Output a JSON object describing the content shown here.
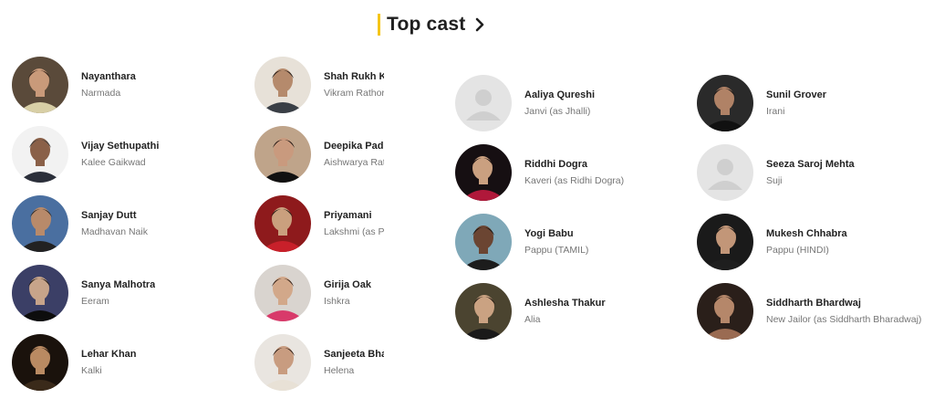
{
  "section": {
    "title": "Top cast",
    "accent": "#f5c518",
    "more_icon": "chevron-right-icon"
  },
  "cast": [
    {
      "name": "Nayanthara",
      "role": "Narmada",
      "avatar": {
        "bg": "#5a4a3a",
        "skin": "#c99a7a",
        "hair": "#2a1c14",
        "cloth": "#d8cfa6"
      }
    },
    {
      "name": "Vijay Sethupathi",
      "role": "Kalee Gaikwad",
      "avatar": {
        "bg": "#f2f2f2",
        "skin": "#8a6048",
        "hair": "#3a3a3a",
        "cloth": "#2b2f3a"
      }
    },
    {
      "name": "Sanjay Dutt",
      "role": "Madhavan Naik",
      "avatar": {
        "bg": "#4a6fa0",
        "skin": "#b88a6a",
        "hair": "#2a2a2a",
        "cloth": "#222"
      }
    },
    {
      "name": "Sanya Malhotra",
      "role": "Eeram",
      "avatar": {
        "bg": "#3b3f66",
        "skin": "#c7a48a",
        "hair": "#1a1410",
        "cloth": "#0d0d0d"
      }
    },
    {
      "name": "Lehar Khan",
      "role": "Kalki",
      "avatar": {
        "bg": "#1a120c",
        "skin": "#b98a62",
        "hair": "#2c1d12",
        "cloth": "#3a2a1a"
      }
    },
    {
      "name": "Shah Rukh Khan",
      "role": "Vikram Rathore",
      "avatar": {
        "bg": "#e7e1d8",
        "skin": "#b58a6c",
        "hair": "#1e1a18",
        "cloth": "#3a3f46"
      }
    },
    {
      "name": "Deepika Padukone",
      "role": "Aishwarya Rathore",
      "avatar": {
        "bg": "#bfa48a",
        "skin": "#c99a7e",
        "hair": "#1c1410",
        "cloth": "#111"
      }
    },
    {
      "name": "Priyamani",
      "role": "Lakshmi (as Priyamani Raj)",
      "avatar": {
        "bg": "#8e1a1c",
        "skin": "#caa07e",
        "hair": "#251812",
        "cloth": "#c8202a"
      }
    },
    {
      "name": "Girija Oak",
      "role": "Ishkra",
      "avatar": {
        "bg": "#d9d4cf",
        "skin": "#d2a88a",
        "hair": "#2a1a12",
        "cloth": "#d83a6a"
      }
    },
    {
      "name": "Sanjeeta Bhattacharya",
      "role": "Helena",
      "avatar": {
        "bg": "#e9e5e0",
        "skin": "#c89c80",
        "hair": "#2b1b12",
        "cloth": "#e8e1d6"
      }
    },
    {
      "name": "Aaliya Qureshi",
      "role": "Janvi (as Jhalli)",
      "placeholder": true
    },
    {
      "name": "Riddhi Dogra",
      "role": "Kaveri (as Ridhi Dogra)",
      "avatar": {
        "bg": "#160f12",
        "skin": "#caa080",
        "hair": "#1a1010",
        "cloth": "#b0183a"
      }
    },
    {
      "name": "Yogi Babu",
      "role": "Pappu (TAMIL)",
      "avatar": {
        "bg": "#7fa8b8",
        "skin": "#6b4532",
        "hair": "#181410",
        "cloth": "#1c1c1c"
      }
    },
    {
      "name": "Ashlesha Thakur",
      "role": "Alia",
      "avatar": {
        "bg": "#4b4430",
        "skin": "#caa282",
        "hair": "#1a120c",
        "cloth": "#1a1a1a"
      }
    },
    {
      "name": "Sunil Grover",
      "role": "Irani",
      "avatar": {
        "bg": "#2a2a2a",
        "skin": "#b08266",
        "hair": "#151515",
        "cloth": "#111"
      }
    },
    {
      "name": "Seeza Saroj Mehta",
      "role": "Suji",
      "placeholder": true
    },
    {
      "name": "Mukesh Chhabra",
      "role": "Pappu (HINDI)",
      "avatar": {
        "bg": "#1a1a1a",
        "skin": "#c29678",
        "hair": "#121212",
        "cloth": "#1e1e1e"
      }
    },
    {
      "name": "Siddharth Bhardwaj",
      "role": "New Jailor (as Siddharth Bharadwaj)",
      "avatar": {
        "bg": "#2a1f1a",
        "skin": "#b5876a",
        "hair": "#1a120e",
        "cloth": "#9a6b52"
      }
    }
  ]
}
